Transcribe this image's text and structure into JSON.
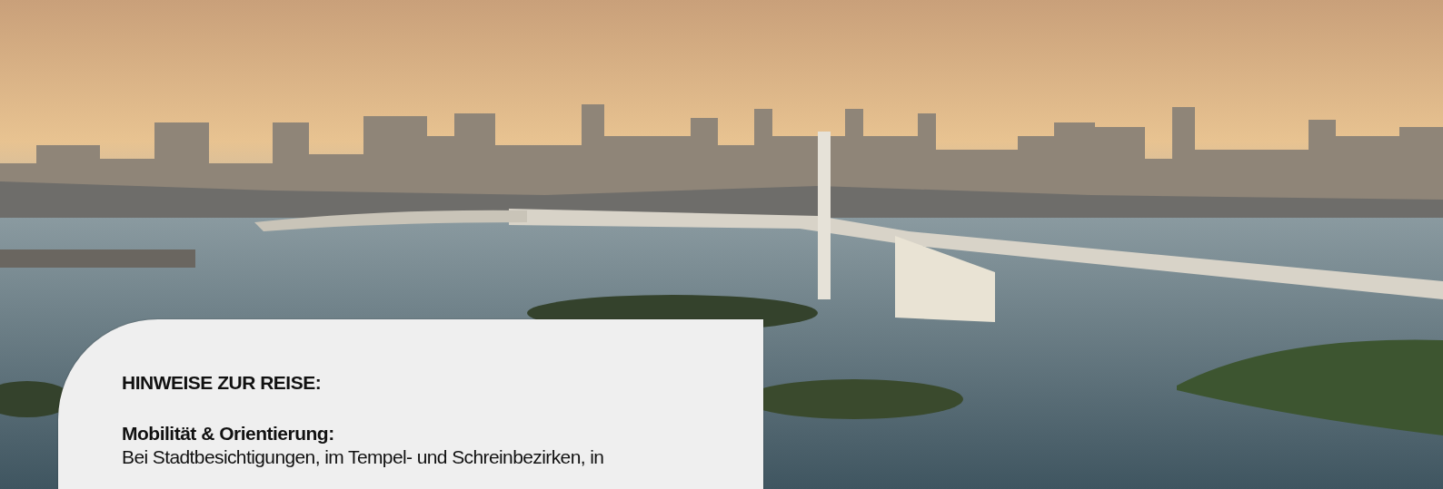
{
  "notice": {
    "heading": "HINWEISE ZUR REISE:",
    "sections": [
      {
        "title": "Mobilität & Orientierung:",
        "text": "Bei Stadtbesichtigungen, im Tempel- und Schreinbezirken, in"
      }
    ]
  }
}
